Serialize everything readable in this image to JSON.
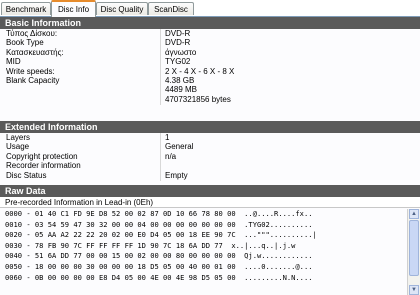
{
  "tabs": [
    {
      "label": "Benchmark"
    },
    {
      "label": "Disc Info"
    },
    {
      "label": "Disc Quality"
    },
    {
      "label": "ScanDisc"
    }
  ],
  "basic": {
    "header": "Basic Information",
    "rows": [
      {
        "label": "Τύπος Δίσκου:",
        "value": "DVD-R"
      },
      {
        "label": "Book Type",
        "value": "DVD-R"
      },
      {
        "label": "Κατασκευαστής:",
        "value": "άγνωστο"
      },
      {
        "label": "MID",
        "value": "TYG02"
      },
      {
        "label": "Write speeds:",
        "value": "2 X - 4 X - 6 X - 8 X"
      },
      {
        "label": "Blank Capacity",
        "value": "4.38 GB"
      },
      {
        "label": "",
        "value": "4489 MB"
      },
      {
        "label": "",
        "value": "4707321856 bytes"
      }
    ]
  },
  "extended": {
    "header": "Extended Information",
    "rows": [
      {
        "label": "Layers",
        "value": "1"
      },
      {
        "label": "Usage",
        "value": "General"
      },
      {
        "label": "Copyright protection",
        "value": "n/a"
      },
      {
        "label": "Recorder information",
        "value": ""
      },
      {
        "label": "Disc Status",
        "value": "Empty"
      }
    ]
  },
  "raw": {
    "header": "Raw Data",
    "title": "Pre-recorded Information in Lead-in (0Eh)",
    "lines": [
      "0000 - 01 40 C1 FD 9E D8 52 00 02 87 0D 10 66 78 80 00  ..@....R....fx..",
      "0010 - 03 54 59 47 30 32 00 00 04 00 00 00 00 00 00 00  .TYG02..........",
      "0020 - 05 AA A2 22 22 20 02 00 E0 D4 05 00 18 EE 90 7C  ...\"\"\"..........|",
      "0030 - 78 FB 90 7C FF FF FF FF 1D 90 7C 18 6A DD 77  x..|...q..|.j.w",
      "0040 - 51 6A DD 77 00 00 15 00 02 00 00 80 00 00 00 00  Qj.w............",
      "0050 - 18 00 00 00 30 00 00 00 18 D5 05 00 40 00 01 00  ....0.......@...",
      "0060 - 0B 00 00 00 00 E8 D4 05 00 4E 00 4E 98 D5 05 00  .........N.N...."
    ]
  },
  "colors": {
    "section_header_bg": "#5a5a5a",
    "active_tab_accent": "#e68b2c"
  },
  "icons": {
    "scroll_up": "scroll-up-arrow-icon",
    "scroll_down": "scroll-down-arrow-icon"
  }
}
